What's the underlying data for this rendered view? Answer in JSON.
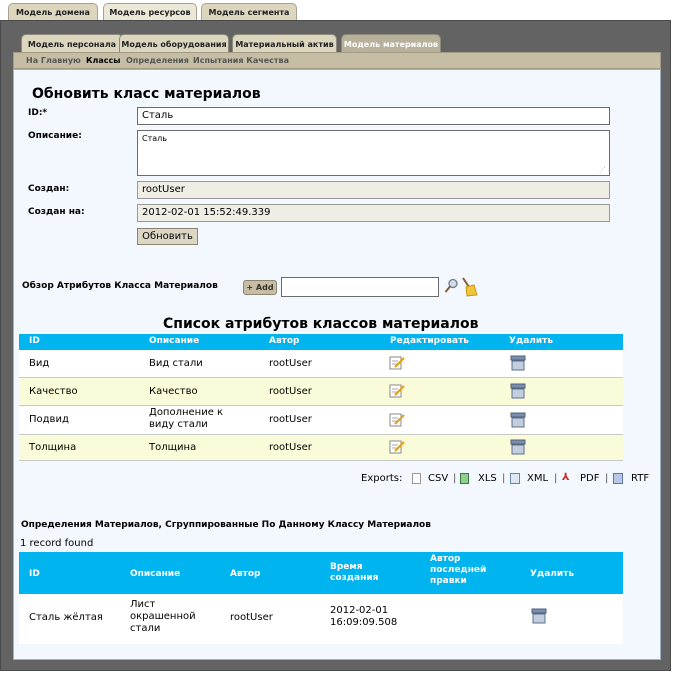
{
  "top_tabs": [
    "Модель домена",
    "Модель ресурсов",
    "Модель сегмента"
  ],
  "sub_tabs": [
    "Модель персонала",
    "Модель оборудования",
    "Материальный актив",
    "Модель материалов"
  ],
  "nav": [
    "На Главную",
    "Классы",
    "Определения",
    "Испытания Качества"
  ],
  "form": {
    "title": "Обновить класс материалов",
    "id_label": "ID:*",
    "id_value": "Сталь",
    "desc_label": "Описание:",
    "desc_value": "Сталь",
    "created_label": "Создан:",
    "created_value": "rootUser",
    "created_on_label": "Создан на:",
    "created_on_value": "2012-02-01 15:52:49.339",
    "update_button": "Обновить"
  },
  "attr_search": {
    "label": "Обзор Атрибутов Класса Материалов",
    "add_button": "+ Add"
  },
  "attr_table": {
    "title": "Список атрибутов классов материалов",
    "headers": [
      "ID",
      "Описание",
      "Автор",
      "Редактировать",
      "Удалить"
    ],
    "rows": [
      {
        "id": "Вид",
        "desc": "Вид стали",
        "author": "rootUser"
      },
      {
        "id": "Качество",
        "desc": "Качество",
        "author": "rootUser"
      },
      {
        "id": "Подвид",
        "desc": "Дополнение к виду стали",
        "author": "rootUser"
      },
      {
        "id": "Толщина",
        "desc": "Толщина",
        "author": "rootUser"
      }
    ]
  },
  "exports": {
    "label": "Exports:",
    "items": [
      "CSV",
      "XLS",
      "XML",
      "PDF",
      "RTF"
    ]
  },
  "defs": {
    "title": "Определения Материалов, Сгруппированные По Данному Классу Материалов",
    "count": "1 record found",
    "headers": [
      "ID",
      "Описание",
      "Автор",
      "Время создания",
      "Автор последней правки",
      "Удалить"
    ],
    "rows": [
      {
        "id": "Сталь жёлтая",
        "desc": "Лист окрашенной стали",
        "author": "rootUser",
        "time": "2012-02-01 16:09:09.508",
        "last": ""
      }
    ]
  }
}
